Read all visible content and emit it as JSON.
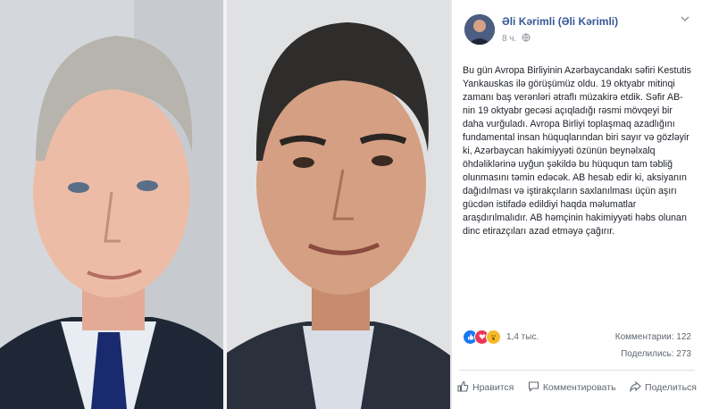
{
  "post": {
    "author": "Əli Kərimli (Əli Kərimli)",
    "time": "8 ч.",
    "privacy_icon": "globe-icon",
    "text": "Bu gün Avropa Birliyinin Azərbaycandakı səfiri Kestutis Yankauskas ilə görüşümüz oldu. 19 oktyabr mitinqi zamanı baş verənləri ətraflı müzakirə etdik. Səfir AB-nin 19 oktyabr gecəsi açıqladığı rəsmi mövqeyi bir daha vurğuladı. Avropa Birliyi toplaşmaq azadlığını fundamental insan hüquqlarından biri sayır və gözləyir ki, Azərbaycan hakimiyyəti özünün beynəlxalq öhdəliklərinə uyğun şəkildə bu hüququn tam təbliğ olunmasını təmin edəcək. AB hesab edir ki, aksiyanın dağıdılması və iştirakçıların saxlanılması üçün aşırı gücdən istifadə edildiyi haqda məlumatlar araşdırılmalıdır. AB həmçinin hakimiyyəti həbs olunan dinc etirazçıları azad etməyə çağırır.",
    "reactions_count": "1,4 тыс.",
    "comments": "Комментарии: 122",
    "shares": "Поделились: 273",
    "actions": {
      "like": "Нравится",
      "comment": "Комментировать",
      "share": "Поделиться"
    }
  },
  "colors": {
    "author": "#385898",
    "like": "#1877f2",
    "love": "#e9375a",
    "wow": "#f7b928"
  }
}
